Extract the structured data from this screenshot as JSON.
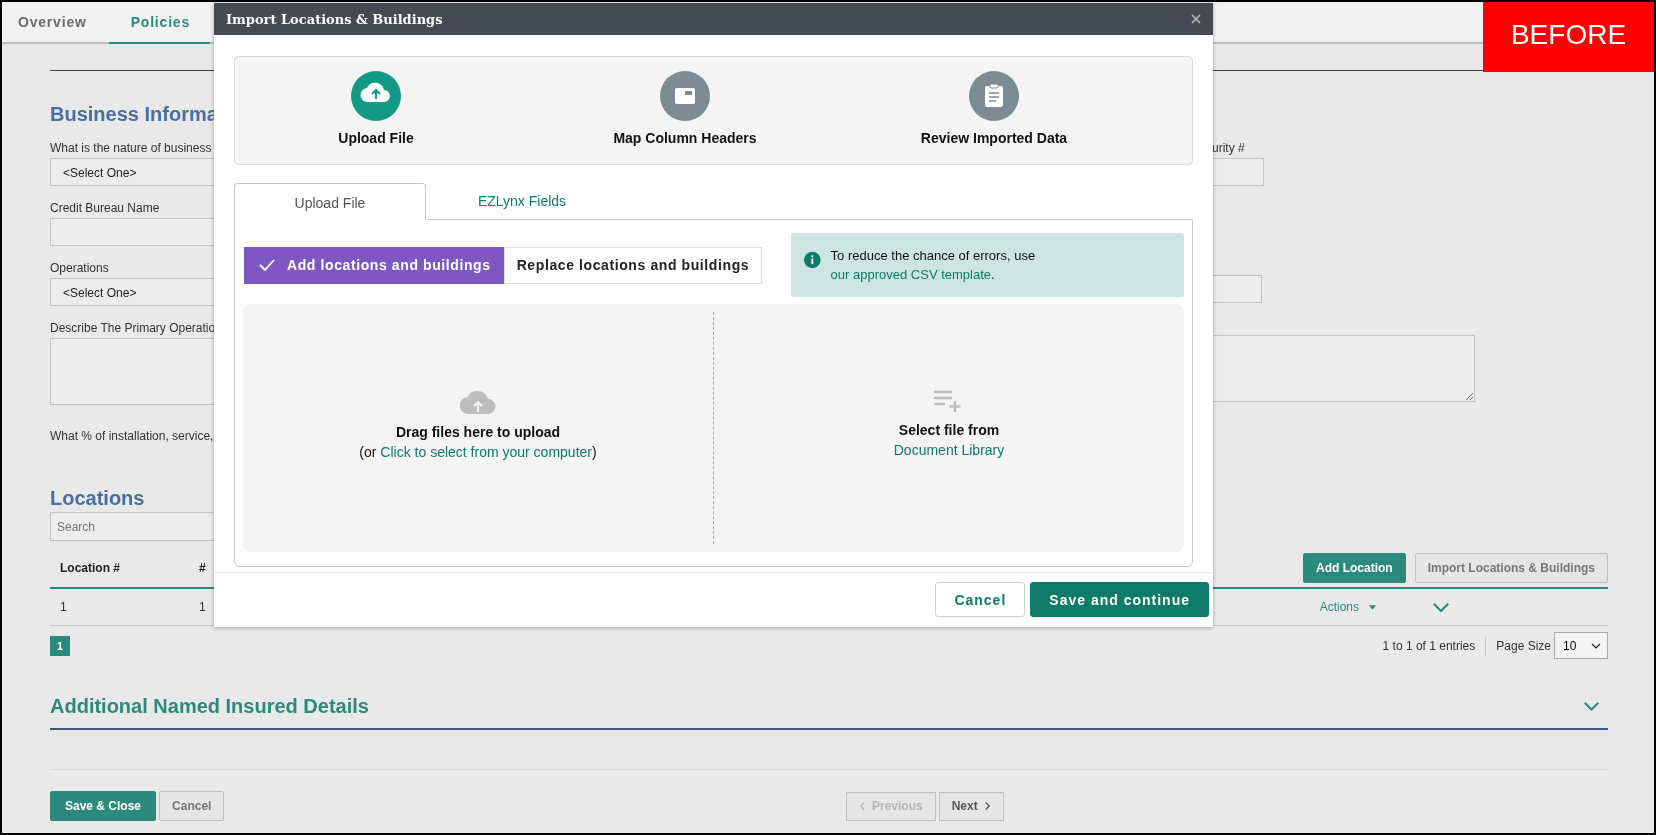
{
  "page_tabs": [
    {
      "label": "Overview",
      "selected": false
    },
    {
      "label": "Policies",
      "selected": true
    }
  ],
  "business_information": {
    "heading": "Business Informa",
    "fields": [
      {
        "kind": "select",
        "label": "What is the nature of business",
        "value": "<Select One>",
        "side_label": "urity #"
      },
      {
        "kind": "text",
        "label": "Credit Bureau Name"
      },
      {
        "kind": "select",
        "label": "Operations",
        "value": "<Select One>"
      },
      {
        "kind": "textarea",
        "label": "Describe The Primary Operatio"
      }
    ],
    "question": "What % of installation, service,"
  },
  "locations": {
    "heading": "Locations",
    "search_placeholder": "Search",
    "columns": [
      "Location #",
      "#"
    ],
    "buttons": [
      {
        "label": "Add Location",
        "kind": "primary"
      },
      {
        "label": "Import Locations & Buildings",
        "kind": "secondary"
      }
    ],
    "rows": [
      {
        "cells": [
          "1",
          "1"
        ],
        "actions": "Actions"
      }
    ],
    "pages": [
      {
        "label": "1",
        "selected": true
      }
    ],
    "entries": "1 to 1 of 1 entries",
    "page_size_label": "Page Size",
    "page_size": "10"
  },
  "additional_section": {
    "heading": "Additional Named Insured Details"
  },
  "footer": {
    "buttons": [
      {
        "label": "Save & Close",
        "kind": "primary"
      },
      {
        "label": "Cancel",
        "kind": "secondary"
      }
    ],
    "pager": [
      {
        "label": "Previous",
        "kind": "previous",
        "disabled": true
      },
      {
        "label": "Next",
        "kind": "next",
        "disabled": false
      }
    ]
  },
  "dialog": {
    "title": "Import Locations & Buildings",
    "steps": [
      {
        "label": "Upload File",
        "kind": "upload",
        "selected": true
      },
      {
        "label": "Map Column Headers",
        "kind": "card",
        "selected": false
      },
      {
        "label": "Review Imported Data",
        "kind": "clipboard",
        "selected": false
      }
    ],
    "tabs": [
      {
        "label": "Upload File",
        "selected": true
      },
      {
        "label": "EZLynx Fields",
        "selected": false
      }
    ],
    "modes": [
      {
        "label": "Add locations and buildings",
        "selected": true
      },
      {
        "label": "Replace locations and buildings",
        "selected": false
      }
    ],
    "notice": {
      "text": "To reduce the chance of errors, use ",
      "link": "our approved CSV template",
      "after": "."
    },
    "upload": {
      "title": "Drag files here to upload",
      "prefix": "(or ",
      "link": "Click to select from your computer",
      "suffix": ")"
    },
    "library": {
      "title": "Select file from",
      "link": "Document Library"
    },
    "buttons": [
      {
        "label": "Cancel",
        "kind": "secondary"
      },
      {
        "label": "Save and continue",
        "kind": "primary"
      }
    ]
  },
  "badge": "BEFORE"
}
